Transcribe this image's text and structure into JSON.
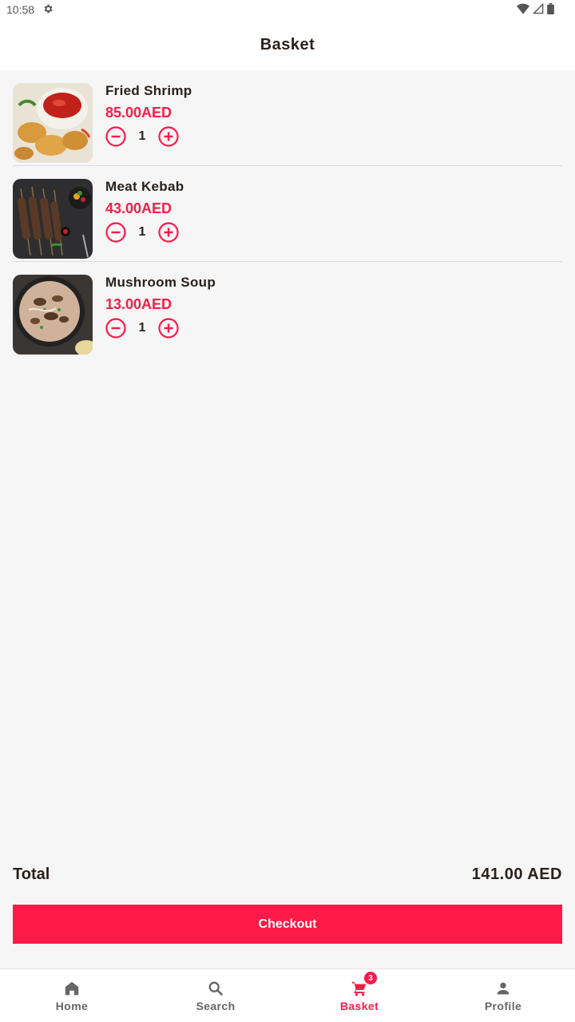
{
  "status_bar": {
    "time": "10:58"
  },
  "header": {
    "title": "Basket"
  },
  "items": [
    {
      "name": "Fried Shrimp",
      "price": "85.00AED",
      "quantity": "1",
      "image": "fried-shrimp-image"
    },
    {
      "name": "Meat Kebab",
      "price": "43.00AED",
      "quantity": "1",
      "image": "meat-kebab-image"
    },
    {
      "name": "Mushroom Soup",
      "price": "13.00AED",
      "quantity": "1",
      "image": "mushroom-soup-image"
    }
  ],
  "total": {
    "label": "Total",
    "value": "141.00 AED"
  },
  "checkout": {
    "label": "Checkout"
  },
  "nav": {
    "items": [
      {
        "label": "Home",
        "icon": "home-icon"
      },
      {
        "label": "Search",
        "icon": "search-icon"
      },
      {
        "label": "Basket",
        "icon": "cart-icon",
        "badge": "3"
      },
      {
        "label": "Profile",
        "icon": "person-icon"
      }
    ],
    "active": "Basket"
  },
  "colors": {
    "accent": "#ff1a47",
    "text": "#2a1f1a",
    "background": "#f6f6f6"
  }
}
